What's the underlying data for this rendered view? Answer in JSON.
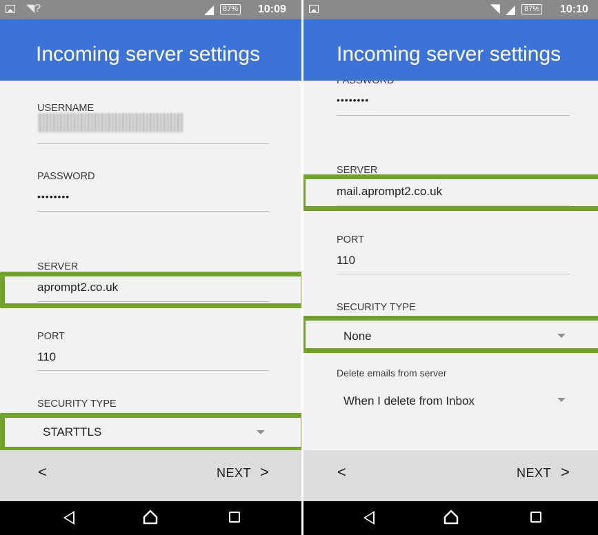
{
  "colors": {
    "app_bar": "#3c73d8",
    "status_bar": "#8a8a8a",
    "highlight": "#74a12c",
    "background": "#f2f2f2",
    "nav_row": "#dcdcdc",
    "system_bar": "#000000"
  },
  "left": {
    "status": {
      "battery": "87%",
      "time": "10:09",
      "wifi_icon": "wifi-question-icon",
      "signal_icon": "signal-icon"
    },
    "title": "Incoming server settings",
    "username": {
      "label": "USERNAME",
      "value_icon": "blurred-username"
    },
    "password": {
      "label": "PASSWORD",
      "value": "••••••••"
    },
    "server": {
      "label": "SERVER",
      "value": "aprompt2.co.uk"
    },
    "port": {
      "label": "PORT",
      "value": "110"
    },
    "security": {
      "label": "SECURITY TYPE",
      "value": "STARTTLS"
    },
    "nav": {
      "back": "<",
      "next": "NEXT",
      "next_chevron": ">"
    }
  },
  "right": {
    "status": {
      "battery": "87%",
      "time": "10:10",
      "wifi_icon": "wifi-icon",
      "signal_icon": "signal-icon"
    },
    "title": "Incoming server settings",
    "password": {
      "label": "PASSWORD",
      "value": "••••••••"
    },
    "server": {
      "label": "SERVER",
      "value": "mail.aprompt2.co.uk"
    },
    "port": {
      "label": "PORT",
      "value": "110"
    },
    "security": {
      "label": "SECURITY TYPE",
      "value": "None"
    },
    "delete": {
      "label": "Delete emails from server",
      "value": "When I delete from Inbox"
    },
    "nav": {
      "back": "<",
      "next": "NEXT",
      "next_chevron": ">"
    }
  }
}
